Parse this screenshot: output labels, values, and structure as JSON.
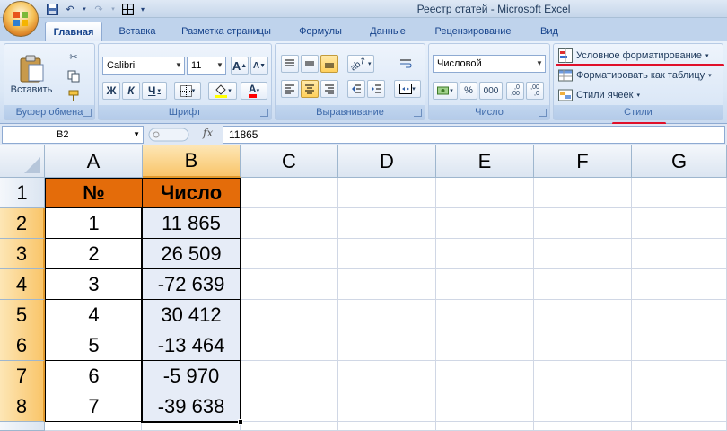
{
  "title_bar": {
    "title": "Реестр статей - Microsoft Excel"
  },
  "tabs": [
    {
      "label": "Главная",
      "active": true
    },
    {
      "label": "Вставка",
      "active": false
    },
    {
      "label": "Разметка страницы",
      "active": false
    },
    {
      "label": "Формулы",
      "active": false
    },
    {
      "label": "Данные",
      "active": false
    },
    {
      "label": "Рецензирование",
      "active": false
    },
    {
      "label": "Вид",
      "active": false
    }
  ],
  "ribbon": {
    "clipboard": {
      "group_label": "Буфер обмена",
      "paste_label": "Вставить"
    },
    "font": {
      "group_label": "Шрифт",
      "font_name": "Calibri",
      "font_size": "11",
      "grow_label": "A",
      "shrink_label": "A",
      "bold_label": "Ж",
      "italic_label": "К",
      "underline_label": "Ч",
      "font_color_label": "A"
    },
    "alignment": {
      "group_label": "Выравнивание"
    },
    "number": {
      "group_label": "Число",
      "format": "Числовой",
      "percent_label": "%",
      "thousands_label": "000",
      "increase_decimal": ",0\n,00",
      "decrease_decimal": ",00\n,0"
    },
    "styles": {
      "group_label": "Стили",
      "conditional_formatting": "Условное форматирование",
      "format_as_table": "Форматировать как таблицу",
      "cell_styles": "Стили ячеек"
    }
  },
  "formula_bar": {
    "name_box": "B2",
    "fx_label": "fx",
    "formula_value": "11865"
  },
  "sheet": {
    "columns": [
      "A",
      "B",
      "C",
      "D",
      "E",
      "F",
      "G"
    ],
    "rows": [
      "1",
      "2",
      "3",
      "4",
      "5",
      "6",
      "7",
      "8"
    ],
    "header_row": [
      "№",
      "Число"
    ],
    "data_rows": [
      [
        "1",
        "11 865"
      ],
      [
        "2",
        "26 509"
      ],
      [
        "3",
        "-72 639"
      ],
      [
        "4",
        "30 412"
      ],
      [
        "5",
        "-13 464"
      ],
      [
        "6",
        "-5 970"
      ],
      [
        "7",
        "-39 638"
      ]
    ]
  },
  "colors": {
    "header_fill": "#e46c0a",
    "selection_fill": "#e6ecf7",
    "highlight_red": "#e0102a"
  }
}
